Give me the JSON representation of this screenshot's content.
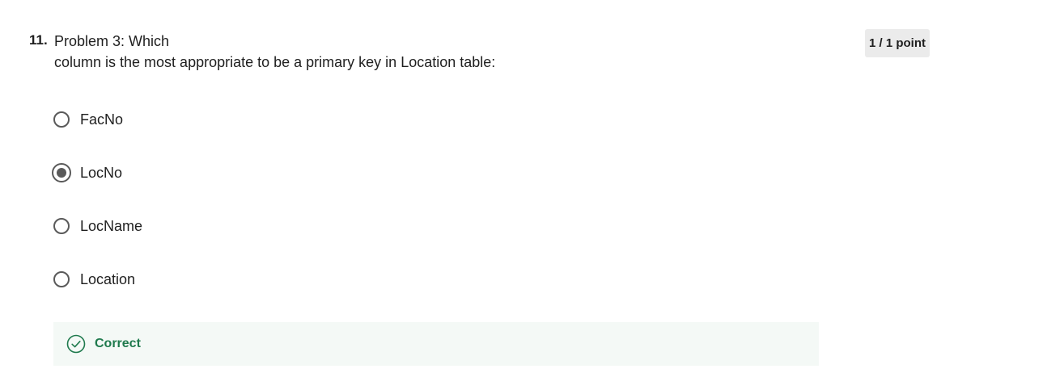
{
  "question": {
    "number": "11.",
    "text_line1": "Problem 3: Which",
    "text_line2": "column is the most appropriate to be a primary key in Location table:",
    "points": "1 / 1 point"
  },
  "options": [
    {
      "label": "FacNo",
      "selected": false
    },
    {
      "label": "LocNo",
      "selected": true
    },
    {
      "label": "LocName",
      "selected": false
    },
    {
      "label": "Location",
      "selected": false
    }
  ],
  "feedback": {
    "label": "Correct",
    "icon": "check-circle-icon",
    "color": "#1f7a4d",
    "background": "#f4f9f6"
  }
}
